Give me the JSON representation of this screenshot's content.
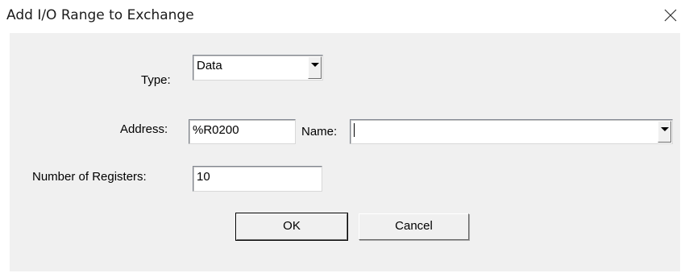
{
  "window": {
    "title": "Add I/O Range to Exchange"
  },
  "form": {
    "type_label": "Type:",
    "type_value": "Data",
    "address_label": "Address:",
    "address_value": "%R0200",
    "name_label": "Name:",
    "name_value": "",
    "registers_label": "Number of Registers:",
    "registers_value": "10"
  },
  "buttons": {
    "ok_label": "OK",
    "cancel_label": "Cancel"
  },
  "icons": {
    "close": "close-icon",
    "dropdown": "chevron-down-icon"
  }
}
